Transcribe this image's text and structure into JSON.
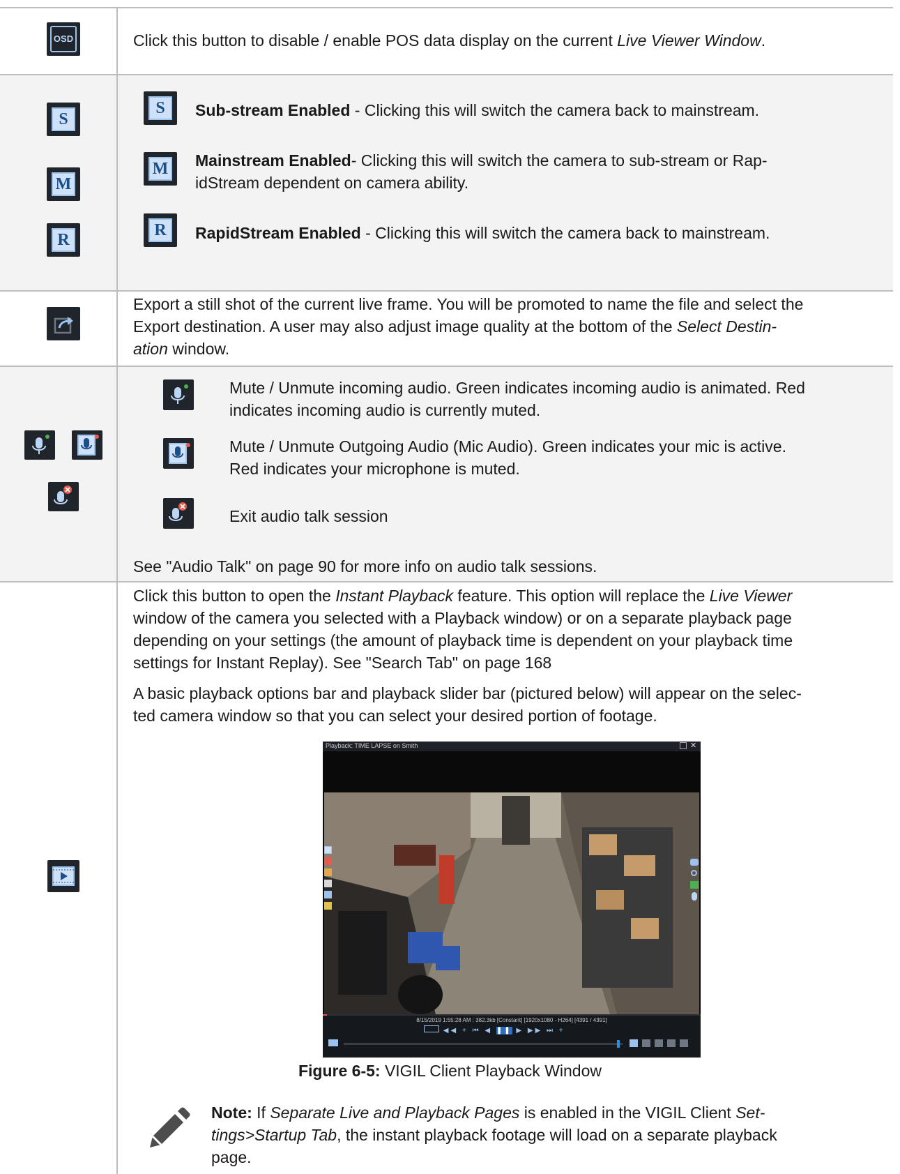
{
  "rows": {
    "osd": {
      "icon": "osd-icon",
      "icon_label": "OSD",
      "text_1": "Click this button to disable / enable POS data display on the current ",
      "text_italic": "Live Viewer Window",
      "text_2": "."
    },
    "stream": {
      "sub_icon_label": "S",
      "main_icon_label": "M",
      "rapid_icon_label": "R",
      "sub_bold": "Sub-stream Enabled",
      "sub_text": " - Clicking this will switch the camera back to mainstream.",
      "main_bold": "Mainstream Enabled",
      "main_text_1": "- Clicking this will switch the camera to sub-stream or Rap-",
      "main_text_2": "idStream dependent on camera ability.",
      "rapid_bold": "RapidStream Enabled",
      "rapid_text": " - Clicking this will switch the camera back to mainstream."
    },
    "export": {
      "line1": "Export a still shot of the current live frame. You will be promoted to name the file and select the",
      "line2_a": "Export destination. A user may also adjust image quality at the bottom of the ",
      "line2_i": "Select Destin-",
      "line3_i": "ation",
      "line3_b": " window."
    },
    "audio": {
      "incoming_1": "Mute / Unmute incoming audio. Green indicates incoming audio is animated. Red",
      "incoming_2": "indicates incoming audio is currently muted.",
      "outgoing_1": "Mute / Unmute Outgoing Audio (Mic Audio). Green indicates your mic is active.",
      "outgoing_2": "Red indicates your microphone is muted.",
      "exit": "Exit audio talk session",
      "see": "See \"Audio Talk\" on page 90 for more info on audio talk sessions."
    },
    "playback": {
      "p1_l1_a": "Click this button to open the ",
      "p1_l1_i": "Instant Playback",
      "p1_l1_b": " feature. This option will replace the ",
      "p1_l1_i2": "Live Viewer",
      "p1_l2": "window of the camera you selected with a Playback window) or on a separate playback page",
      "p1_l3": "depending on your settings (the amount of playback time is dependent on your playback time",
      "p1_l4": "settings for Instant Replay). See \"Search Tab\" on page 168",
      "p2_l1": "A basic playback options bar and playback slider bar (pictured below) will appear on the selec-",
      "p2_l2": "ted camera window so that you can select your desired portion of footage.",
      "window_title": "Playback: TIME LAPSE on Smith",
      "status_line": "8/15/2019 1:55:28 AM : 382.3kb [Constant] [1920x1080 - H264] [4391 / 4391]",
      "figure_label": "Figure 6-5:",
      "figure_text": " VIGIL Client Playback Window",
      "note_label": "Note:",
      "note_l1_a": " If ",
      "note_l1_i": "Separate Live and Playback Pages",
      "note_l1_b": " is enabled in the VIGIL Client ",
      "note_l1_i2": "Set-",
      "note_l2_i": "tings>Startup Tab",
      "note_l2_b": ", the instant playback footage will load on a separate playback",
      "note_l3": "page."
    }
  },
  "colors": {
    "accent_blue": "#9cc2ee",
    "icon_dark": "#20242b",
    "green": "#4caf50",
    "red": "#e55a4a"
  }
}
